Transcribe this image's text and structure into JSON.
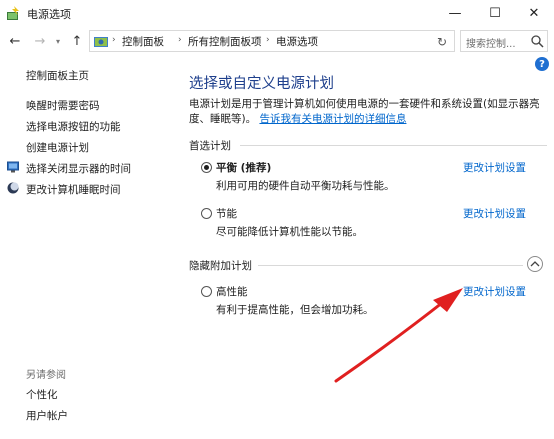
{
  "window": {
    "title": "电源选项",
    "minimize_glyph": "—",
    "maximize_glyph": "☐",
    "close_glyph": "✕"
  },
  "nav": {
    "back_glyph": "←",
    "forward_glyph": "→",
    "recent_glyph": "▾",
    "up_glyph": "↑"
  },
  "address": {
    "breadcrumbs": [
      "控制面板",
      "所有控制面板项",
      "电源选项"
    ],
    "separator": "›",
    "dropdown_glyph": "▾",
    "refresh_glyph": "↻"
  },
  "search": {
    "placeholder": "搜索控制..."
  },
  "sidebar": {
    "home": "控制面板主页",
    "items": [
      {
        "label": "唤醒时需要密码",
        "icon": null
      },
      {
        "label": "选择电源按钮的功能",
        "icon": null
      },
      {
        "label": "创建电源计划",
        "icon": null
      },
      {
        "label": "选择关闭显示器的时间",
        "icon": "monitor-icon"
      },
      {
        "label": "更改计算机睡眠时间",
        "icon": "moon-icon"
      }
    ],
    "see_also_heading": "另请参阅",
    "see_also": [
      "个性化",
      "用户帐户"
    ]
  },
  "main": {
    "title": "选择或自定义电源计划",
    "description_line1": "电源计划是用于管理计算机如何使用电源的一套硬件和系统设置(如显示器亮",
    "description_line2": "度、睡眠等)。",
    "description_link": "告诉我有关电源计划的详细信息",
    "preferred_header": "首选计划",
    "hidden_header": "隐藏附加计划",
    "plans": [
      {
        "name": "平衡 (推荐)",
        "desc": "利用可用的硬件自动平衡功耗与性能。",
        "link": "更改计划设置",
        "selected": true
      },
      {
        "name": "节能",
        "desc": "尽可能降低计算机性能以节能。",
        "link": "更改计划设置",
        "selected": false
      },
      {
        "name": "高性能",
        "desc": "有利于提高性能，但会增加功耗。",
        "link": "更改计划设置",
        "selected": false
      }
    ],
    "help_glyph": "?"
  },
  "colors": {
    "title_blue": "#1e3f8c",
    "link_blue": "#0066cc",
    "annotation_red": "#e02020"
  }
}
